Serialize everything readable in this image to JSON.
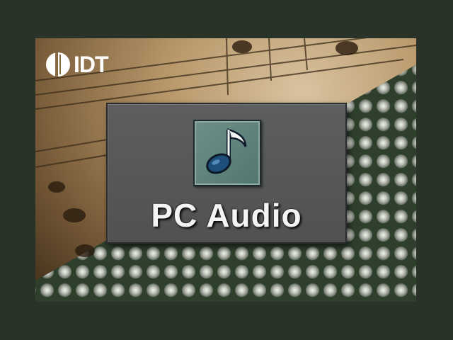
{
  "brand": {
    "logo_text": "IDT"
  },
  "main": {
    "title": "PC Audio",
    "icon": "music-note-icon"
  },
  "colors": {
    "background": "#2a3328",
    "panel": "#55575a",
    "icon_tile": "#5f837c",
    "title_text": "#f4f4f4"
  }
}
